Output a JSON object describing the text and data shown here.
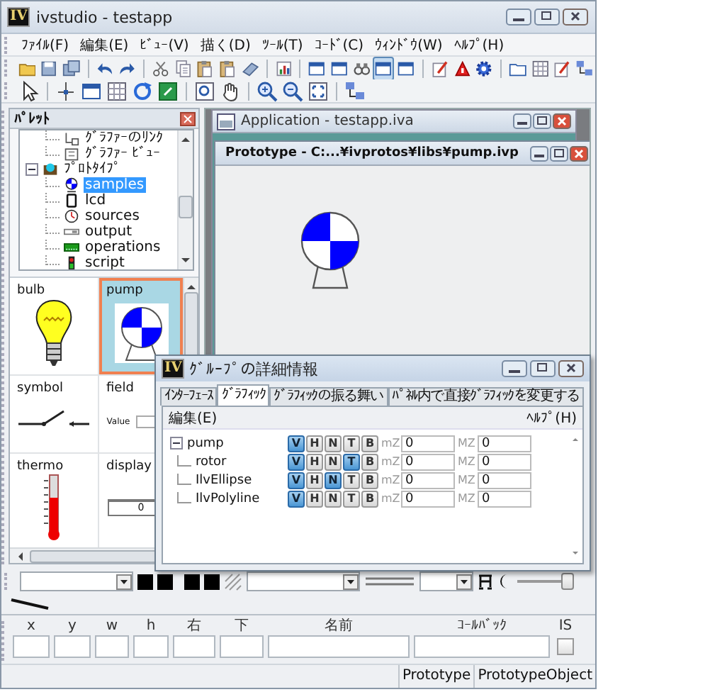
{
  "window": {
    "logo": "IV",
    "title": "ivstudio - testapp"
  },
  "menu": [
    {
      "label": "ﾌｧｲﾙ(F)"
    },
    {
      "label": "編集(E)"
    },
    {
      "label": "ﾋﾞｭｰ(V)"
    },
    {
      "label": "描く(D)"
    },
    {
      "label": "ﾂｰﾙ(T)"
    },
    {
      "label": "ｺｰﾄﾞ(C)"
    },
    {
      "label": "ｳｨﾝﾄﾞｳ(W)"
    },
    {
      "label": "ﾍﾙﾌﾟ(H)"
    }
  ],
  "toolbars": [
    {
      "items": [
        {
          "kind": "folder",
          "pressed": false
        },
        {
          "kind": "disk",
          "pressed": false
        },
        {
          "kind": "disks",
          "pressed": false
        },
        {
          "kind": "separator"
        },
        {
          "kind": "undo",
          "pressed": false
        },
        {
          "kind": "redo",
          "pressed": false
        },
        {
          "kind": "separator"
        },
        {
          "kind": "scissors",
          "pressed": false
        },
        {
          "kind": "documents",
          "pressed": false
        },
        {
          "kind": "clipboard",
          "pressed": false
        },
        {
          "kind": "clipboard",
          "pressed": false
        },
        {
          "kind": "eraser",
          "pressed": false
        },
        {
          "kind": "separator"
        },
        {
          "kind": "chart",
          "pressed": false
        },
        {
          "kind": "separator"
        },
        {
          "kind": "window",
          "pressed": false
        },
        {
          "kind": "window",
          "pressed": false
        },
        {
          "kind": "binoculars",
          "pressed": false
        },
        {
          "kind": "window",
          "pressed": true
        },
        {
          "kind": "window",
          "pressed": false
        },
        {
          "kind": "separator"
        },
        {
          "kind": "pencil",
          "pressed": false
        },
        {
          "kind": "triangle",
          "pressed": false
        },
        {
          "kind": "gear",
          "pressed": false
        },
        {
          "kind": "separator"
        },
        {
          "kind": "folder-outline",
          "pressed": false
        },
        {
          "kind": "grid",
          "pressed": false
        },
        {
          "kind": "pencil",
          "pressed": false
        },
        {
          "kind": "network",
          "pressed": false
        }
      ]
    },
    {
      "items": [
        {
          "kind": "pointer",
          "pressed": false
        },
        {
          "kind": "separator"
        },
        {
          "kind": "nodes",
          "pressed": false
        },
        {
          "kind": "window",
          "pressed": false
        },
        {
          "kind": "grid",
          "pressed": false
        },
        {
          "kind": "rotate",
          "pressed": false
        },
        {
          "kind": "greenbox",
          "pressed": false
        },
        {
          "kind": "separator"
        },
        {
          "kind": "zoombox",
          "pressed": false
        },
        {
          "kind": "hand",
          "pressed": false
        },
        {
          "kind": "separator"
        },
        {
          "kind": "zoomin",
          "pressed": false
        },
        {
          "kind": "zoomout",
          "pressed": false
        },
        {
          "kind": "fit",
          "pressed": false
        },
        {
          "kind": "separator"
        },
        {
          "kind": "network",
          "pressed": false
        }
      ]
    }
  ],
  "palette": {
    "title": "ﾊﾟﾚｯﾄ",
    "tree": [
      {
        "children": [
          {
            "label": "ｸﾞﾗﾌｧｰのﾘﾝｸ",
            "kind": "link",
            "selected": false
          },
          {
            "label": "ｸﾞﾗﾌｧｰ ﾋﾞｭｰ",
            "kind": "view",
            "selected": false
          }
        ]
      },
      {
        "label": "ﾌﾟﾛﾄﾀｲﾌﾟ",
        "kind": "prototype",
        "expanded": true,
        "selected": false,
        "children": [
          {
            "label": "samples",
            "kind": "samples",
            "selected": true
          },
          {
            "label": "lcd",
            "kind": "lcd",
            "selected": false
          },
          {
            "label": "sources",
            "kind": "sources",
            "selected": false
          },
          {
            "label": "output",
            "kind": "output",
            "selected": false
          },
          {
            "label": "operations",
            "kind": "operations",
            "selected": false
          },
          {
            "label": "script",
            "kind": "script",
            "selected": false
          }
        ]
      }
    ],
    "items": [
      {
        "label": "bulb",
        "kind": "bulb",
        "selected": false
      },
      {
        "label": "pump",
        "kind": "pump",
        "selected": true
      },
      {
        "label": "symbol",
        "kind": "switch",
        "selected": false
      },
      {
        "label": "field",
        "kind": "field",
        "caption": "Value",
        "selected": false
      },
      {
        "label": "thermo",
        "kind": "thermometer",
        "selected": false
      },
      {
        "label": "display",
        "kind": "display",
        "reading": "0",
        "selected": false
      }
    ]
  },
  "application_window": {
    "title": "Application - testapp.iva"
  },
  "prototype_window": {
    "title": "Prototype - C:...¥ivprotos¥libs¥pump.ivp"
  },
  "group_dialog": {
    "logo": "IV",
    "title": "ｸﾞﾙｰﾌﾟの詳細情報",
    "tabs": [
      {
        "label": "ｲﾝﾀｰﾌｪｰｽ",
        "selected": false
      },
      {
        "label": "ｸﾞﾗﾌｨｯｸ",
        "selected": true
      },
      {
        "label": "ｸﾞﾗﾌｨｯｸの振る舞い",
        "selected": false
      },
      {
        "label": "ﾊﾟﾈﾙ内で直接ｸﾞﾗﾌｨｯｸを変更する",
        "selected": false
      }
    ],
    "menu": [
      {
        "label": "編集(E)"
      },
      {
        "label": "ﾍﾙﾌﾟ(H)"
      }
    ],
    "rows": [
      {
        "name": "pump",
        "expanded": true,
        "toggles": [
          {
            "label": "V",
            "on": true
          },
          {
            "label": "H",
            "on": false
          },
          {
            "label": "N",
            "on": false
          },
          {
            "label": "T",
            "on": false
          },
          {
            "label": "B",
            "on": false
          }
        ],
        "min_label": "mZ",
        "min_value": "0",
        "max_label": "MZ",
        "max_value": "0",
        "children": [
          {
            "name": "rotor",
            "toggles": [
              {
                "label": "V",
                "on": true
              },
              {
                "label": "H",
                "on": false
              },
              {
                "label": "N",
                "on": false
              },
              {
                "label": "T",
                "on": true
              },
              {
                "label": "B",
                "on": false
              }
            ],
            "min_label": "mZ",
            "min_value": "0",
            "max_label": "MZ",
            "max_value": "0"
          },
          {
            "name": "IlvEllipse",
            "toggles": [
              {
                "label": "V",
                "on": true
              },
              {
                "label": "H",
                "on": false
              },
              {
                "label": "N",
                "on": true
              },
              {
                "label": "T",
                "on": false
              },
              {
                "label": "B",
                "on": false
              }
            ],
            "min_label": "mZ",
            "min_value": "0",
            "max_label": "MZ",
            "max_value": "0"
          },
          {
            "name": "IlvPolyline",
            "toggles": [
              {
                "label": "V",
                "on": true
              },
              {
                "label": "H",
                "on": false
              },
              {
                "label": "N",
                "on": false
              },
              {
                "label": "T",
                "on": false
              },
              {
                "label": "B",
                "on": false
              }
            ],
            "min_label": "mZ",
            "min_value": "0",
            "max_label": "MZ",
            "max_value": "0"
          }
        ]
      }
    ]
  },
  "style_toolbar": {
    "items": [
      {
        "kind": "combo"
      },
      {
        "kind": "swatch"
      },
      {
        "kind": "swatch"
      },
      {
        "kind": "gap"
      },
      {
        "kind": "swatch"
      },
      {
        "kind": "swatch"
      },
      {
        "kind": "hatch"
      },
      {
        "kind": "combo"
      },
      {
        "kind": "double-line"
      },
      {
        "kind": "small-combo"
      },
      {
        "kind": "arch"
      },
      {
        "kind": "crescent"
      },
      {
        "kind": "slider",
        "level": 0.9
      }
    ]
  },
  "properties": {
    "fields": [
      {
        "label": "x"
      },
      {
        "label": "y"
      },
      {
        "label": "w"
      },
      {
        "label": "h"
      },
      {
        "label": "右"
      },
      {
        "label": "下"
      },
      {
        "label": "名前"
      },
      {
        "label": "ｺｰﾙﾊﾞｯｸ"
      }
    ],
    "flag": {
      "label": "IS",
      "checked": false
    }
  },
  "status_bar": [
    {
      "text": "Prototype"
    },
    {
      "text": "PrototypeObject"
    }
  ]
}
